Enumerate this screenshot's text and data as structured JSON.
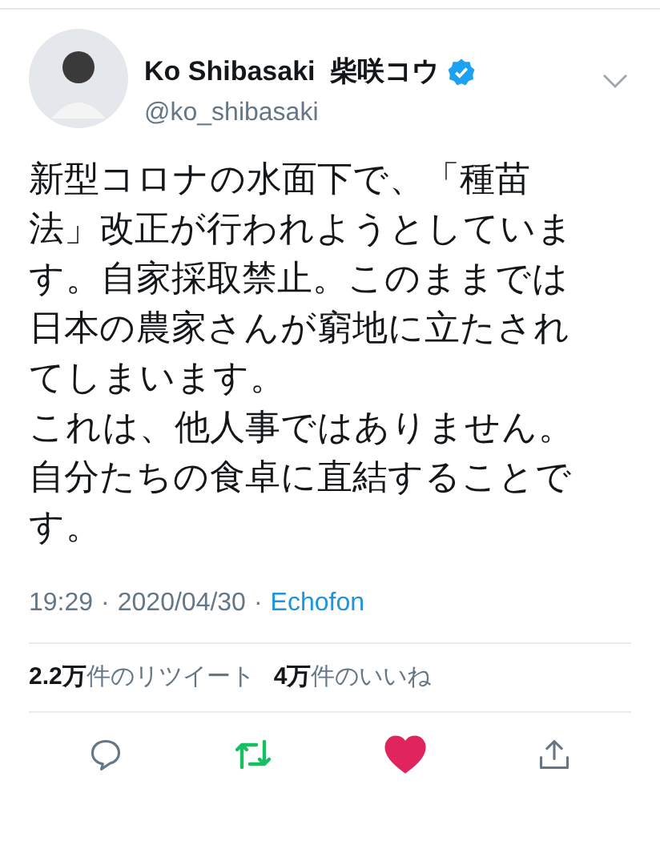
{
  "author": {
    "name": "Ko Shibasaki  柴咲コウ",
    "verified": true,
    "handle": "@ko_shibasaki"
  },
  "tweet": {
    "paragraphs": [
      "新型コロナの水面下で、「種苗法」改正が行われようとしています。自家採取禁止。このままでは日本の農家さんが窮地に立たされてしまいます。",
      "これは、他人事ではありません。自分たちの食卓に直結することです。"
    ]
  },
  "meta": {
    "time": "19:29",
    "separator": "·",
    "date": "2020/04/30",
    "source": "Echofon"
  },
  "stats": [
    {
      "count": "2.2万",
      "label": "件のリツイート"
    },
    {
      "count": "4万",
      "label": "件のいいね"
    }
  ],
  "actions": {
    "retweeted": true,
    "liked": true
  }
}
